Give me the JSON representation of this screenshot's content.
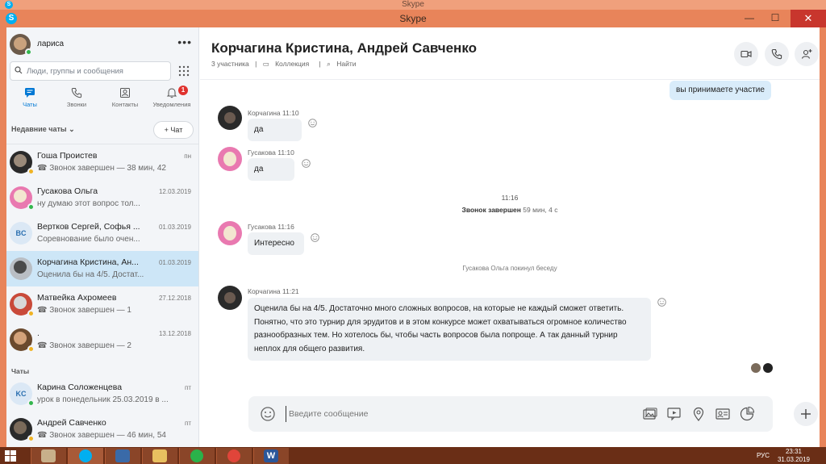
{
  "ghost": {
    "title": "Skype",
    "logo": "S"
  },
  "window": {
    "title": "Skype",
    "logo": "S",
    "minimize": "—",
    "maximize": "☐",
    "close": "✕"
  },
  "colors": {
    "accent": "#0078d4",
    "skype": "#00aff0",
    "selected": "#cde6f7",
    "online": "#33b64d",
    "away": "#f0b323",
    "titlebar": "#e8845a",
    "close": "#c8362d"
  },
  "profile": {
    "name": "лариса",
    "more": "•••"
  },
  "search": {
    "placeholder": "Люди, группы и сообщения",
    "value": ""
  },
  "nav": [
    {
      "label": "Чаты",
      "icon": "chat-icon"
    },
    {
      "label": "Звонки",
      "icon": "phone-icon"
    },
    {
      "label": "Контакты",
      "icon": "contacts-icon"
    },
    {
      "label": "Уведомления",
      "icon": "bell-icon",
      "badge": "1"
    }
  ],
  "recent": {
    "label": "Недавние чаты",
    "chevron": "⌄",
    "new_chat": "Чат",
    "new_chat_icon": "+"
  },
  "chats": [
    {
      "name": "Гоша Проистев",
      "date": "пн",
      "preview": "Звонок завершен — 38 мин, 42",
      "call": true
    },
    {
      "name": "Гусакова Ольга",
      "date": "12.03.2019",
      "preview": "ну думаю этот вопрос тол...",
      "call": false
    },
    {
      "name": "Вертков Сергей, Софья ...",
      "date": "01.03.2019",
      "preview": "Соревнование было очен...",
      "initials": "BC",
      "call": false
    },
    {
      "name": "Корчагина Кристина, Ан...",
      "date": "01.03.2019",
      "preview": "Оценила бы на 4/5. Достат...",
      "call": false
    },
    {
      "name": "Матвейка Ахромеев",
      "date": "27.12.2018",
      "preview": "Звонок завершен — 1",
      "call": true
    },
    {
      "name": ".",
      "date": "13.12.2018",
      "preview": "Звонок завершен — 2",
      "call": true
    }
  ],
  "chats_section": "Чаты",
  "chats2": [
    {
      "name": "Карина Соложенцева",
      "date": "пт",
      "preview": "урок в понедельник 25.03.2019 в ...",
      "initials": "KC",
      "call": false
    },
    {
      "name": "Андрей Савченко",
      "date": "пт",
      "preview": "Звонок завершен — 46 мин, 54",
      "call": true
    }
  ],
  "conversation": {
    "title": "Корчагина Кристина, Андрей Савченко",
    "participants": "3 участника",
    "sep": "|",
    "gallery": "Коллекция",
    "find": "Найти"
  },
  "messages": {
    "mine_top": "вы принимаете участие",
    "m1": {
      "sender": "Корчагина 11:10",
      "text": "да"
    },
    "m2": {
      "sender": "Гусакова 11:10",
      "text": "да"
    },
    "call": {
      "time": "11:16",
      "label": "Звонок завершен",
      "duration": "59 мин, 4 с"
    },
    "m3": {
      "sender": "Гусакова 11:16",
      "text": "Интересно"
    },
    "left_note": "Гусакова Ольга покинул беседу",
    "m4": {
      "sender": "Корчагина 11:21",
      "text": "Оценила бы на 4/5. Достаточно много сложных вопросов, на которые не каждый сможет ответить. Понятно, что это турнир для эрудитов и в этом конкурсе может охватываться огромное количество разнообразных тем. Но хотелось бы, чтобы часть вопросов была попроще. А так данный турнир неплох для общего развития."
    }
  },
  "composer": {
    "placeholder": "Введите сообщение",
    "value": ""
  },
  "taskbar": {
    "lang": "РУС",
    "time": "23:31",
    "date": "31.03.2019",
    "word_label": "W"
  }
}
